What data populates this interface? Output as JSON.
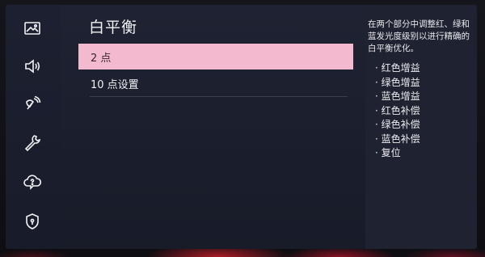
{
  "sidebar": {
    "items": [
      {
        "icon": "picture-icon",
        "active": true
      },
      {
        "icon": "sound-icon",
        "active": false
      },
      {
        "icon": "broadcast-icon",
        "active": false
      },
      {
        "icon": "wrench-icon",
        "active": false
      },
      {
        "icon": "support-icon",
        "active": false
      },
      {
        "icon": "privacy-shield-icon",
        "active": false
      }
    ]
  },
  "main": {
    "title": "白平衡",
    "options": [
      {
        "label": "2 点",
        "selected": true
      },
      {
        "label": "10 点设置",
        "selected": false
      }
    ]
  },
  "description": {
    "text": "在两个部分中调整红、绿和蓝发光度级别以进行精确的白平衡优化。",
    "items": [
      "· 红色增益",
      "· 绿色增益",
      "· 蓝色增益",
      "· 红色补偿",
      "· 绿色补偿",
      "· 蓝色补偿",
      "· 复位"
    ]
  },
  "colors": {
    "selection": "#f2b9cf",
    "panel": "#1e2232",
    "accent_glow": "#c81e28"
  }
}
